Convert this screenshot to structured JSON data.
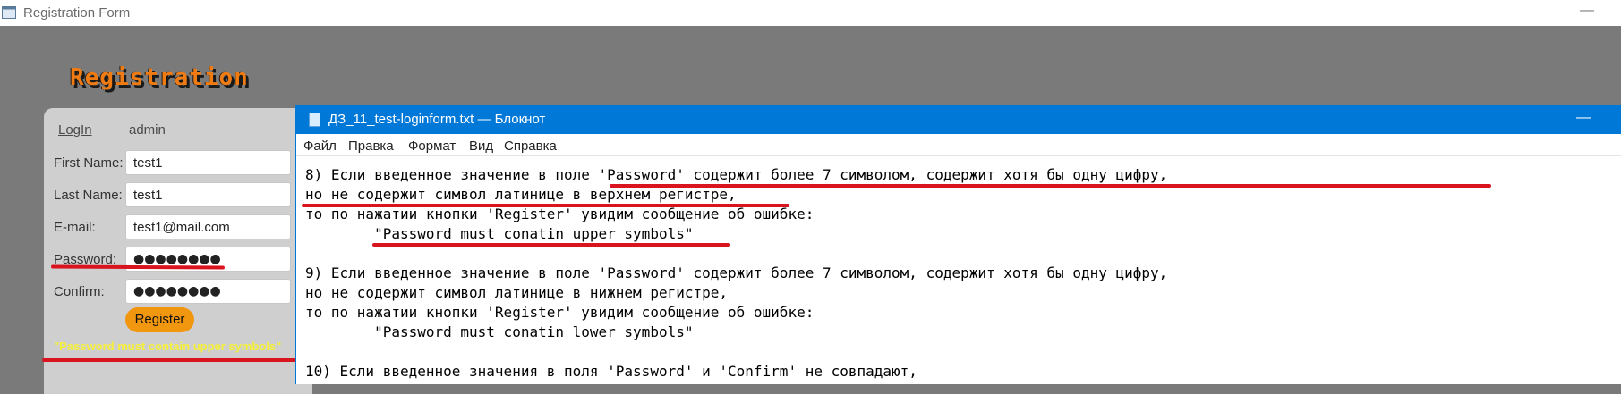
{
  "registration_window": {
    "title": "Registration Form",
    "minimize_glyph": "—",
    "heading": "Registration",
    "login_link": "LogIn",
    "admin_link": "admin",
    "fields": {
      "first_name": {
        "label": "First Name:",
        "value": "test1"
      },
      "last_name": {
        "label": "Last Name:",
        "value": "test1"
      },
      "email": {
        "label": "E-mail:",
        "value": "test1@mail.com"
      },
      "password": {
        "label": "Password:",
        "value": "●●●●●●●●"
      },
      "confirm": {
        "label": "Confirm:",
        "value": "●●●●●●●●"
      }
    },
    "register_button": "Register",
    "error_message": "\"Password must contain upper symbols\""
  },
  "notepad_window": {
    "title": "ДЗ_11_test-loginform.txt — Блокнот",
    "minimize_glyph": "—",
    "menu": [
      "Файл",
      "Правка",
      "Формат",
      "Вид",
      "Справка"
    ],
    "lines": [
      "8) Если введенное значение в поле 'Password' содержит более 7 символом, содержит хотя бы одну цифру,",
      "но не содержит символ латинице в верхнем регистре,",
      "то по нажатии кнопки 'Register' увидим сообщение об ошибке:",
      "        \"Password must conatin upper symbols\"",
      "",
      "9) Если введенное значение в поле 'Password' содержит более 7 символом, содержит хотя бы одну цифру,",
      "но не содержит символ латинице в нижнем регистре,",
      "то по нажатии кнопки 'Register' увидим сообщение об ошибке:",
      "        \"Password must conatin lower symbols\"",
      "",
      "10) Если введенное значения в поля 'Password' и 'Confirm' не совпадают,"
    ]
  },
  "colors": {
    "annotation_red": "#d9141e",
    "notepad_titlebar": "#0078d7",
    "register_button": "#f0960f",
    "error_text": "#f5ef3a",
    "heading_orange": "#f07b12"
  }
}
